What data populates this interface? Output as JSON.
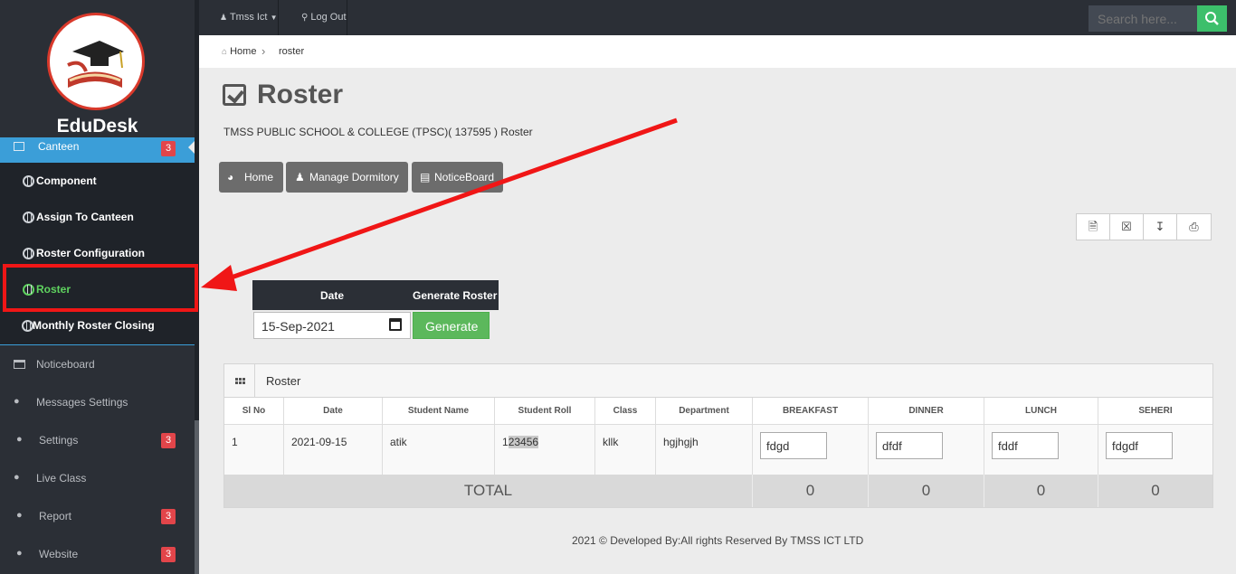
{
  "app": {
    "brand": "EduDesk"
  },
  "topbar": {
    "user_label": "Tmss Ict",
    "logout_label": "Log Out",
    "search_placeholder": "Search here..."
  },
  "sidebar": {
    "active_item": {
      "label": "Canteen",
      "badge": "3"
    },
    "sub_items": [
      {
        "label": "Component"
      },
      {
        "label": "Assign To Canteen"
      },
      {
        "label": "Roster Configuration"
      },
      {
        "label": "Roster",
        "active": true
      },
      {
        "label": "Monthly Roster Closing"
      }
    ],
    "items": [
      {
        "label": "Noticeboard",
        "badge": ""
      },
      {
        "label": "Messages Settings",
        "badge": ""
      },
      {
        "label": "Settings",
        "badge": "3"
      },
      {
        "label": "Live Class",
        "badge": ""
      },
      {
        "label": "Report",
        "badge": "3"
      },
      {
        "label": "Website",
        "badge": "3"
      }
    ]
  },
  "breadcrumb": {
    "home": "Home",
    "current": "roster"
  },
  "page": {
    "title": "Roster",
    "subtitle": "TMSS PUBLIC SCHOOL & COLLEGE (TPSC)( 137595 ) Roster",
    "buttons": {
      "home": "Home",
      "manage_dormitory": "Manage Dormitory",
      "noticeboard": "NoticeBoard"
    }
  },
  "generator": {
    "date_header": "Date",
    "generate_header": "Generate Roster",
    "date_value": "15-Sep-2021",
    "generate_button": "Generate"
  },
  "roster_table": {
    "panel_title": "Roster",
    "columns": [
      "Sl No",
      "Date",
      "Student Name",
      "Student Roll",
      "Class",
      "Department",
      "BREAKFAST",
      "DINNER",
      "LUNCH",
      "SEHERI"
    ],
    "rows": [
      {
        "sl_no": "1",
        "date": "2021-09-15",
        "student_name": "atik",
        "student_roll_prefix": "1",
        "student_roll_selected": "23456",
        "class": "kllk",
        "department": "hgjhgjh",
        "breakfast": "fdgd",
        "dinner": "dfdf",
        "lunch": "fddf",
        "seheri": "fdgdf"
      }
    ],
    "total_label": "TOTAL",
    "totals": {
      "breakfast": "0",
      "dinner": "0",
      "lunch": "0",
      "seheri": "0"
    }
  },
  "footer": {
    "text": "2021 © Developed By:All rights Reserved By TMSS ICT LTD"
  },
  "colors": {
    "sidebar": "#2b2f36",
    "active": "#3b9ed8",
    "badge": "#e2454a",
    "success": "#5cb85c",
    "annotation": "#f01616"
  }
}
